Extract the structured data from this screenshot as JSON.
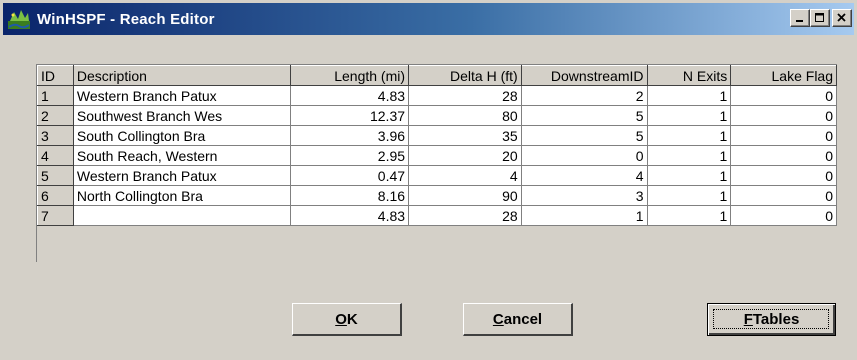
{
  "window": {
    "title": "WinHSPF - Reach Editor"
  },
  "title_buttons": {
    "minimize": "_",
    "maximize": "□",
    "close": "×"
  },
  "grid": {
    "columns": [
      "ID",
      "Description",
      "Length (mi)",
      "Delta H (ft)",
      "DownstreamID",
      "N Exits",
      "Lake Flag"
    ],
    "rows": [
      [
        "1",
        "Western Branch Patux",
        "4.83",
        "28",
        "2",
        "1",
        "0"
      ],
      [
        "2",
        "Southwest Branch Wes",
        "12.37",
        "80",
        "5",
        "1",
        "0"
      ],
      [
        "3",
        "South Collington Bra",
        "3.96",
        "35",
        "5",
        "1",
        "0"
      ],
      [
        "4",
        "South Reach, Western",
        "2.95",
        "20",
        "0",
        "1",
        "0"
      ],
      [
        "5",
        "Western Branch Patux",
        "0.47",
        "4",
        "4",
        "1",
        "0"
      ],
      [
        "6",
        "North Collington Bra",
        "8.16",
        "90",
        "3",
        "1",
        "0"
      ],
      [
        "7",
        "",
        "4.83",
        "28",
        "1",
        "1",
        "0"
      ]
    ]
  },
  "buttons": {
    "ok": {
      "accel": "O",
      "rest": "K"
    },
    "cancel": {
      "accel": "C",
      "rest": "ancel"
    },
    "ftables": {
      "accel": "F",
      "rest": "Tables"
    }
  }
}
